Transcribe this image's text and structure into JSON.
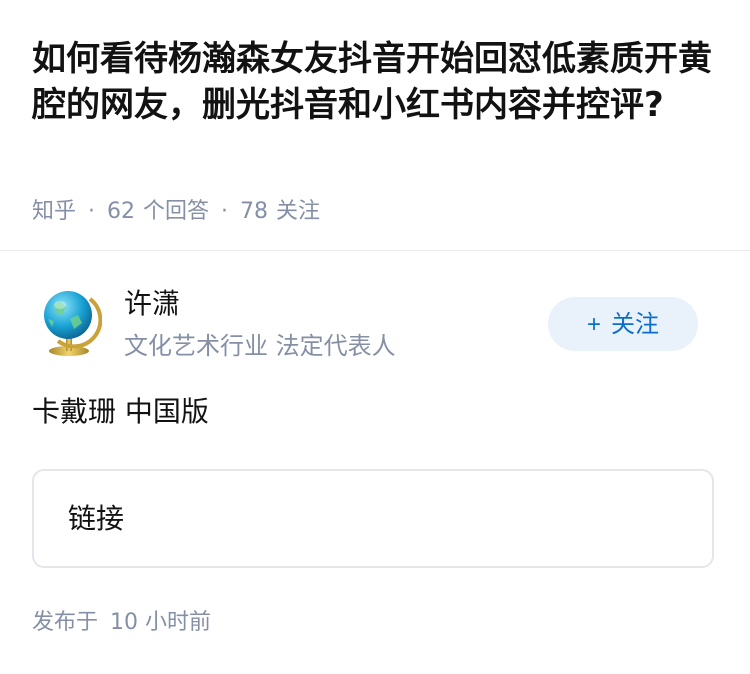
{
  "question": {
    "title": "如何看待杨瀚森女友抖音开始回怼低素质开黄腔的网友，删光抖音和小红书内容并控评?",
    "source": "知乎",
    "separator": "·",
    "answer_count": "62",
    "answer_label": "个回答",
    "follow_count": "78",
    "follow_label": "关注"
  },
  "answer": {
    "author": {
      "name": "许潇",
      "bio": "文化艺术行业 法定代表人",
      "avatar_icon": "globe-icon"
    },
    "follow_button": {
      "plus": "+",
      "label": "关注"
    },
    "content": "卡戴珊 中国版",
    "link_card_label": "链接",
    "publish_label": "发布于",
    "publish_time": "10 小时前"
  },
  "colors": {
    "text_primary": "#121212",
    "text_secondary": "#8590a6",
    "accent_blue": "#0a6ec9",
    "follow_bg": "#e9f1fa",
    "border": "#e4e6ea"
  }
}
